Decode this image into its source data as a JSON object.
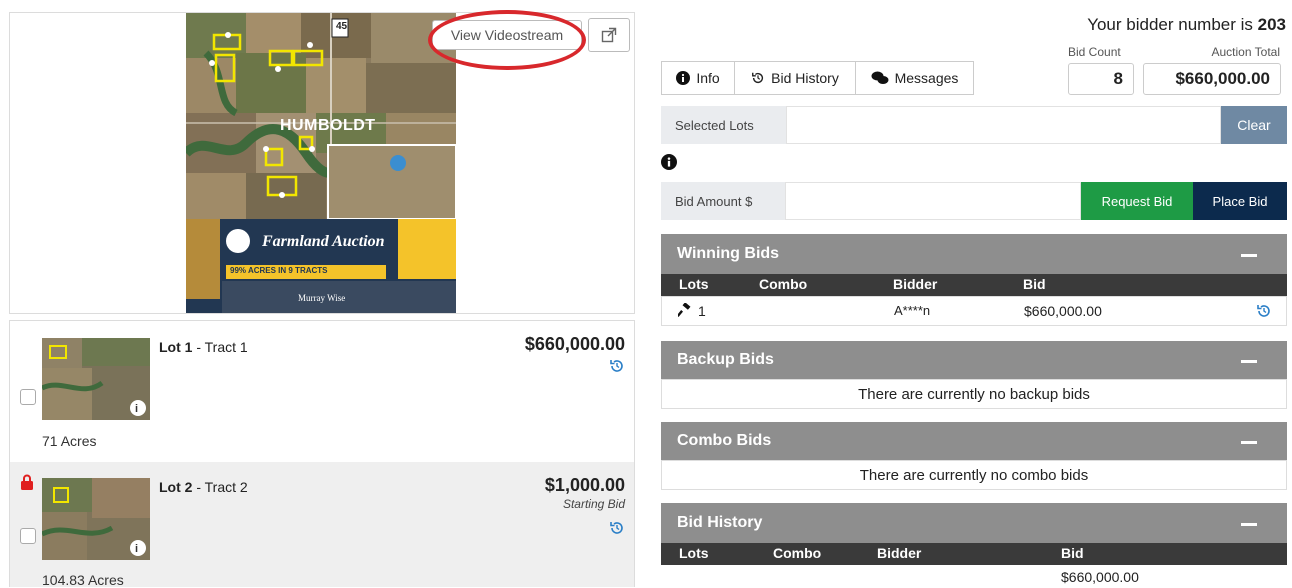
{
  "map": {
    "view_videostream": "View Videostream",
    "town_label": "HUMBOLDT",
    "route_label": "45",
    "banner_title": "Farmland Auction",
    "banner_acres": "99% ACRES IN 9 TRACTS",
    "banner_company": "Murray Wise"
  },
  "lots": [
    {
      "lot": "Lot 1",
      "tract": " - Tract 1",
      "price": "$660,000.00",
      "note": "",
      "acres": "71 Acres"
    },
    {
      "lot": "Lot 2",
      "tract": " - Tract 2",
      "price": "$1,000.00",
      "note": "Starting Bid",
      "acres": "104.83 Acres"
    }
  ],
  "bidder": {
    "prefix": "Your bidder number is ",
    "number": "203",
    "bid_count_label": "Bid Count",
    "bid_count": "8",
    "auction_total_label": "Auction Total",
    "auction_total": "$660,000.00"
  },
  "tabs": [
    "Info",
    "Bid History",
    "Messages"
  ],
  "selected_lots": {
    "label": "Selected Lots",
    "value": "",
    "clear": "Clear"
  },
  "bid_amount": {
    "label": "Bid Amount $",
    "value": "",
    "request": "Request Bid",
    "place": "Place Bid"
  },
  "winning_bids": {
    "title": "Winning Bids",
    "columns": [
      "Lots",
      "Combo",
      "Bidder",
      "Bid"
    ],
    "row": {
      "lot": "1",
      "combo": "",
      "bidder": "A****n",
      "bid": "$660,000.00"
    }
  },
  "backup_bids": {
    "title": "Backup Bids",
    "empty": "There are currently no backup bids"
  },
  "combo_bids": {
    "title": "Combo Bids",
    "empty": "There are currently no combo bids"
  },
  "bid_history": {
    "title": "Bid History",
    "columns": [
      "Lots",
      "Combo",
      "Bidder",
      "Bid"
    ],
    "row": {
      "bid": "$660,000.00"
    }
  },
  "colors": {
    "accent_blue": "#2b7fc7",
    "request_green": "#1e9b45",
    "place_navy": "#0c2a4d",
    "clear_slate": "#6f89a3",
    "panel_gray": "#8e8e8e",
    "oval_red": "#d8282c"
  }
}
